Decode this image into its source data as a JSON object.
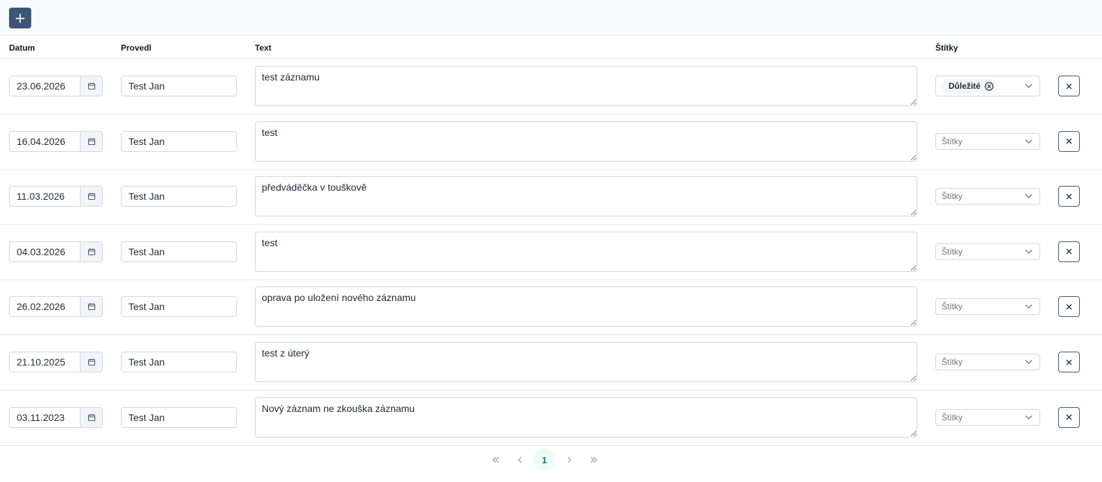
{
  "toolbar": {
    "add_label": "+"
  },
  "columns": {
    "date": "Datum",
    "performed_by": "Provedl",
    "text": "Text",
    "tags": "Štítky"
  },
  "tags_placeholder": "Štítky",
  "rows": [
    {
      "date": "23.06.2026",
      "performed_by": "Test Jan",
      "text": "test záznamu",
      "tags": [
        "Důležité"
      ]
    },
    {
      "date": "16.04.2026",
      "performed_by": "Test Jan",
      "text": "test",
      "tags": []
    },
    {
      "date": "11.03.2026",
      "performed_by": "Test Jan",
      "text": "předváděčka v touškově",
      "tags": []
    },
    {
      "date": "04.03.2026",
      "performed_by": "Test Jan",
      "text": "test",
      "tags": []
    },
    {
      "date": "26.02.2026",
      "performed_by": "Test Jan",
      "text": "oprava po uložení nového záznamu",
      "tags": []
    },
    {
      "date": "21.10.2025",
      "performed_by": "Test Jan",
      "text": "test z úterý",
      "tags": []
    },
    {
      "date": "03.11.2023",
      "performed_by": "Test Jan",
      "text": "Nový záznam ne zkouška záznamu",
      "tags": []
    }
  ],
  "pagination": {
    "current_page": "1"
  },
  "colors": {
    "accent": "#3d5677",
    "header_bg": "#f8fafc",
    "border": "#d1d5db",
    "page_active_bg": "#ecfdf5",
    "page_active_text": "#0f766e"
  },
  "icons": {
    "add": "plus-icon",
    "date_picker": "calendar-icon",
    "tag_remove": "circle-x-icon",
    "dropdown": "chevron-down-icon",
    "delete": "close-icon",
    "first_page": "double-chevron-left-icon",
    "prev_page": "chevron-left-icon",
    "next_page": "chevron-right-icon",
    "last_page": "double-chevron-right-icon"
  }
}
